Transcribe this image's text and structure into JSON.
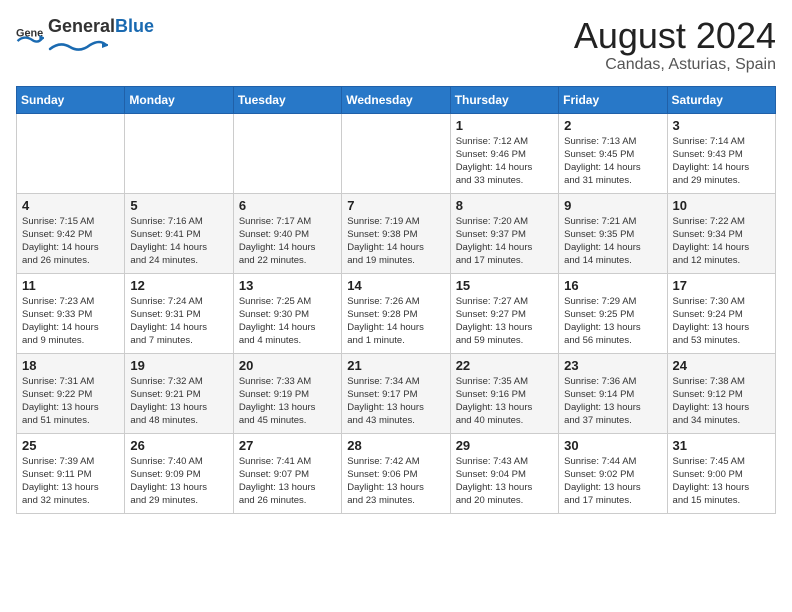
{
  "logo": {
    "general": "General",
    "blue": "Blue"
  },
  "title": {
    "month": "August 2024",
    "location": "Candas, Asturias, Spain"
  },
  "days_of_week": [
    "Sunday",
    "Monday",
    "Tuesday",
    "Wednesday",
    "Thursday",
    "Friday",
    "Saturday"
  ],
  "weeks": [
    [
      {
        "day": "",
        "info": ""
      },
      {
        "day": "",
        "info": ""
      },
      {
        "day": "",
        "info": ""
      },
      {
        "day": "",
        "info": ""
      },
      {
        "day": "1",
        "info": "Sunrise: 7:12 AM\nSunset: 9:46 PM\nDaylight: 14 hours\nand 33 minutes."
      },
      {
        "day": "2",
        "info": "Sunrise: 7:13 AM\nSunset: 9:45 PM\nDaylight: 14 hours\nand 31 minutes."
      },
      {
        "day": "3",
        "info": "Sunrise: 7:14 AM\nSunset: 9:43 PM\nDaylight: 14 hours\nand 29 minutes."
      }
    ],
    [
      {
        "day": "4",
        "info": "Sunrise: 7:15 AM\nSunset: 9:42 PM\nDaylight: 14 hours\nand 26 minutes."
      },
      {
        "day": "5",
        "info": "Sunrise: 7:16 AM\nSunset: 9:41 PM\nDaylight: 14 hours\nand 24 minutes."
      },
      {
        "day": "6",
        "info": "Sunrise: 7:17 AM\nSunset: 9:40 PM\nDaylight: 14 hours\nand 22 minutes."
      },
      {
        "day": "7",
        "info": "Sunrise: 7:19 AM\nSunset: 9:38 PM\nDaylight: 14 hours\nand 19 minutes."
      },
      {
        "day": "8",
        "info": "Sunrise: 7:20 AM\nSunset: 9:37 PM\nDaylight: 14 hours\nand 17 minutes."
      },
      {
        "day": "9",
        "info": "Sunrise: 7:21 AM\nSunset: 9:35 PM\nDaylight: 14 hours\nand 14 minutes."
      },
      {
        "day": "10",
        "info": "Sunrise: 7:22 AM\nSunset: 9:34 PM\nDaylight: 14 hours\nand 12 minutes."
      }
    ],
    [
      {
        "day": "11",
        "info": "Sunrise: 7:23 AM\nSunset: 9:33 PM\nDaylight: 14 hours\nand 9 minutes."
      },
      {
        "day": "12",
        "info": "Sunrise: 7:24 AM\nSunset: 9:31 PM\nDaylight: 14 hours\nand 7 minutes."
      },
      {
        "day": "13",
        "info": "Sunrise: 7:25 AM\nSunset: 9:30 PM\nDaylight: 14 hours\nand 4 minutes."
      },
      {
        "day": "14",
        "info": "Sunrise: 7:26 AM\nSunset: 9:28 PM\nDaylight: 14 hours\nand 1 minute."
      },
      {
        "day": "15",
        "info": "Sunrise: 7:27 AM\nSunset: 9:27 PM\nDaylight: 13 hours\nand 59 minutes."
      },
      {
        "day": "16",
        "info": "Sunrise: 7:29 AM\nSunset: 9:25 PM\nDaylight: 13 hours\nand 56 minutes."
      },
      {
        "day": "17",
        "info": "Sunrise: 7:30 AM\nSunset: 9:24 PM\nDaylight: 13 hours\nand 53 minutes."
      }
    ],
    [
      {
        "day": "18",
        "info": "Sunrise: 7:31 AM\nSunset: 9:22 PM\nDaylight: 13 hours\nand 51 minutes."
      },
      {
        "day": "19",
        "info": "Sunrise: 7:32 AM\nSunset: 9:21 PM\nDaylight: 13 hours\nand 48 minutes."
      },
      {
        "day": "20",
        "info": "Sunrise: 7:33 AM\nSunset: 9:19 PM\nDaylight: 13 hours\nand 45 minutes."
      },
      {
        "day": "21",
        "info": "Sunrise: 7:34 AM\nSunset: 9:17 PM\nDaylight: 13 hours\nand 43 minutes."
      },
      {
        "day": "22",
        "info": "Sunrise: 7:35 AM\nSunset: 9:16 PM\nDaylight: 13 hours\nand 40 minutes."
      },
      {
        "day": "23",
        "info": "Sunrise: 7:36 AM\nSunset: 9:14 PM\nDaylight: 13 hours\nand 37 minutes."
      },
      {
        "day": "24",
        "info": "Sunrise: 7:38 AM\nSunset: 9:12 PM\nDaylight: 13 hours\nand 34 minutes."
      }
    ],
    [
      {
        "day": "25",
        "info": "Sunrise: 7:39 AM\nSunset: 9:11 PM\nDaylight: 13 hours\nand 32 minutes."
      },
      {
        "day": "26",
        "info": "Sunrise: 7:40 AM\nSunset: 9:09 PM\nDaylight: 13 hours\nand 29 minutes."
      },
      {
        "day": "27",
        "info": "Sunrise: 7:41 AM\nSunset: 9:07 PM\nDaylight: 13 hours\nand 26 minutes."
      },
      {
        "day": "28",
        "info": "Sunrise: 7:42 AM\nSunset: 9:06 PM\nDaylight: 13 hours\nand 23 minutes."
      },
      {
        "day": "29",
        "info": "Sunrise: 7:43 AM\nSunset: 9:04 PM\nDaylight: 13 hours\nand 20 minutes."
      },
      {
        "day": "30",
        "info": "Sunrise: 7:44 AM\nSunset: 9:02 PM\nDaylight: 13 hours\nand 17 minutes."
      },
      {
        "day": "31",
        "info": "Sunrise: 7:45 AM\nSunset: 9:00 PM\nDaylight: 13 hours\nand 15 minutes."
      }
    ]
  ]
}
